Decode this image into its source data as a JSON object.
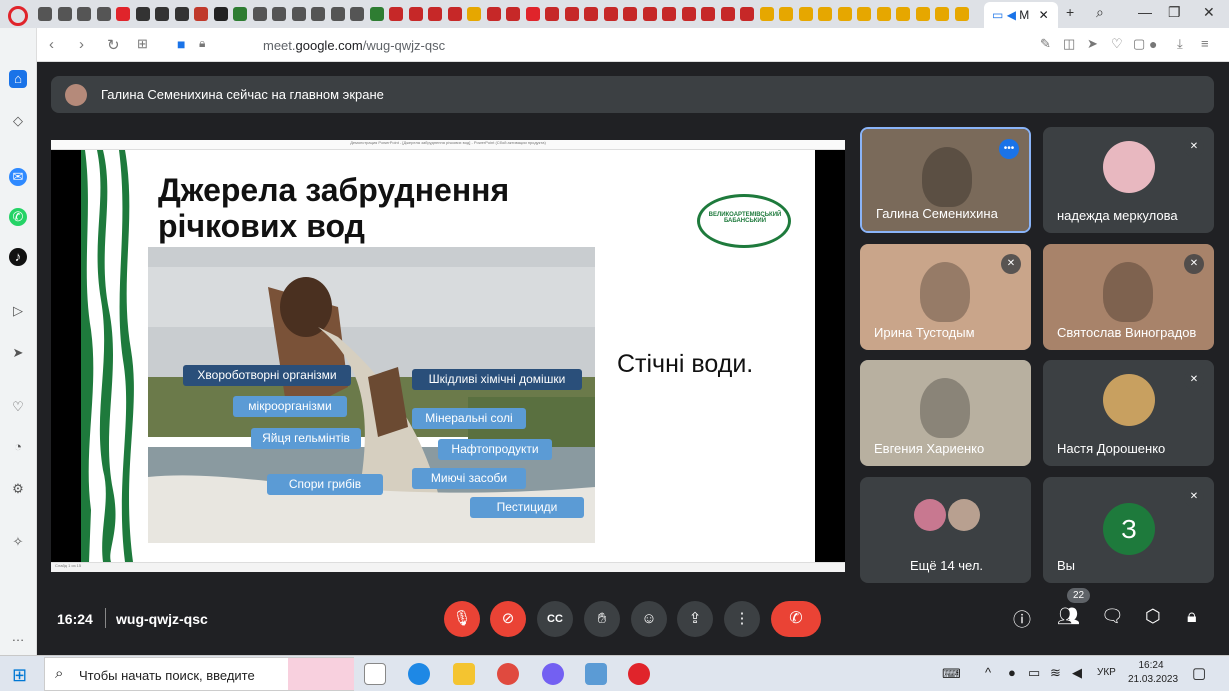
{
  "browser": {
    "active_tab_label": "M",
    "url_prefix": "meet.",
    "url_domain": "google.com",
    "url_path": "/wug-qwjz-qsc"
  },
  "banner": {
    "text": "Галина Семенихина сейчас на главном экране"
  },
  "presentation": {
    "window_title": "Демонстрация PowerPoint - [Джерела забруднення річкових вод] - PowerPoint (Сбой активации продукта)",
    "status_text": "Слайд 1 из 15",
    "slide_title": "Джерела забруднення річкових вод",
    "logo_text": "ВЕЛИКОАРТЕМІВСЬКИЙ БАБАНСЬКИЙ",
    "caption": "Стічні води.",
    "labels": [
      {
        "text": "Хвороботворні організми",
        "style": "dark"
      },
      {
        "text": "мікроорганізми",
        "style": "light"
      },
      {
        "text": "Яйця гельмінтів",
        "style": "light"
      },
      {
        "text": "Спори грибів",
        "style": "light"
      },
      {
        "text": "Шкідливі хімічні домішки",
        "style": "dark"
      },
      {
        "text": "Мінеральні солі",
        "style": "light"
      },
      {
        "text": "Нафтопродукти",
        "style": "light"
      },
      {
        "text": "Миючі засоби",
        "style": "light"
      },
      {
        "text": "Пестициди",
        "style": "light"
      }
    ]
  },
  "participants": [
    {
      "name": "Галина Семенихина",
      "mic": "speaking-icon",
      "type": "video",
      "color": "#7a6a5a"
    },
    {
      "name": "надежда меркулова",
      "mic": "mic-off-icon",
      "type": "avatar",
      "color": "#e8b8c0"
    },
    {
      "name": "Ирина Тустодым",
      "mic": "mic-off-icon",
      "type": "video",
      "color": "#c9a58a"
    },
    {
      "name": "Святослав Виноградов",
      "mic": "mic-off-icon",
      "type": "video",
      "color": "#a8836a"
    },
    {
      "name": "Евгения Хариенко",
      "mic": "",
      "type": "video",
      "color": "#b8b0a0"
    },
    {
      "name": "Настя Дорошенко",
      "mic": "mic-off-icon",
      "type": "avatar",
      "color": "#c8a060"
    },
    {
      "name": "Ещё 14 чел.",
      "mic": "",
      "type": "others",
      "color": "#3c4043"
    },
    {
      "name": "Вы",
      "mic": "mic-off-icon",
      "type": "initial",
      "initial": "З",
      "color": "#1e7a3c"
    }
  ],
  "controls": {
    "time": "16:24",
    "meeting_code": "wug-qwjz-qsc",
    "participant_count": "22"
  },
  "taskbar": {
    "search_placeholder": "Чтобы начать поиск, введите",
    "language": "УКР",
    "time": "16:24",
    "date": "21.03.2023"
  }
}
